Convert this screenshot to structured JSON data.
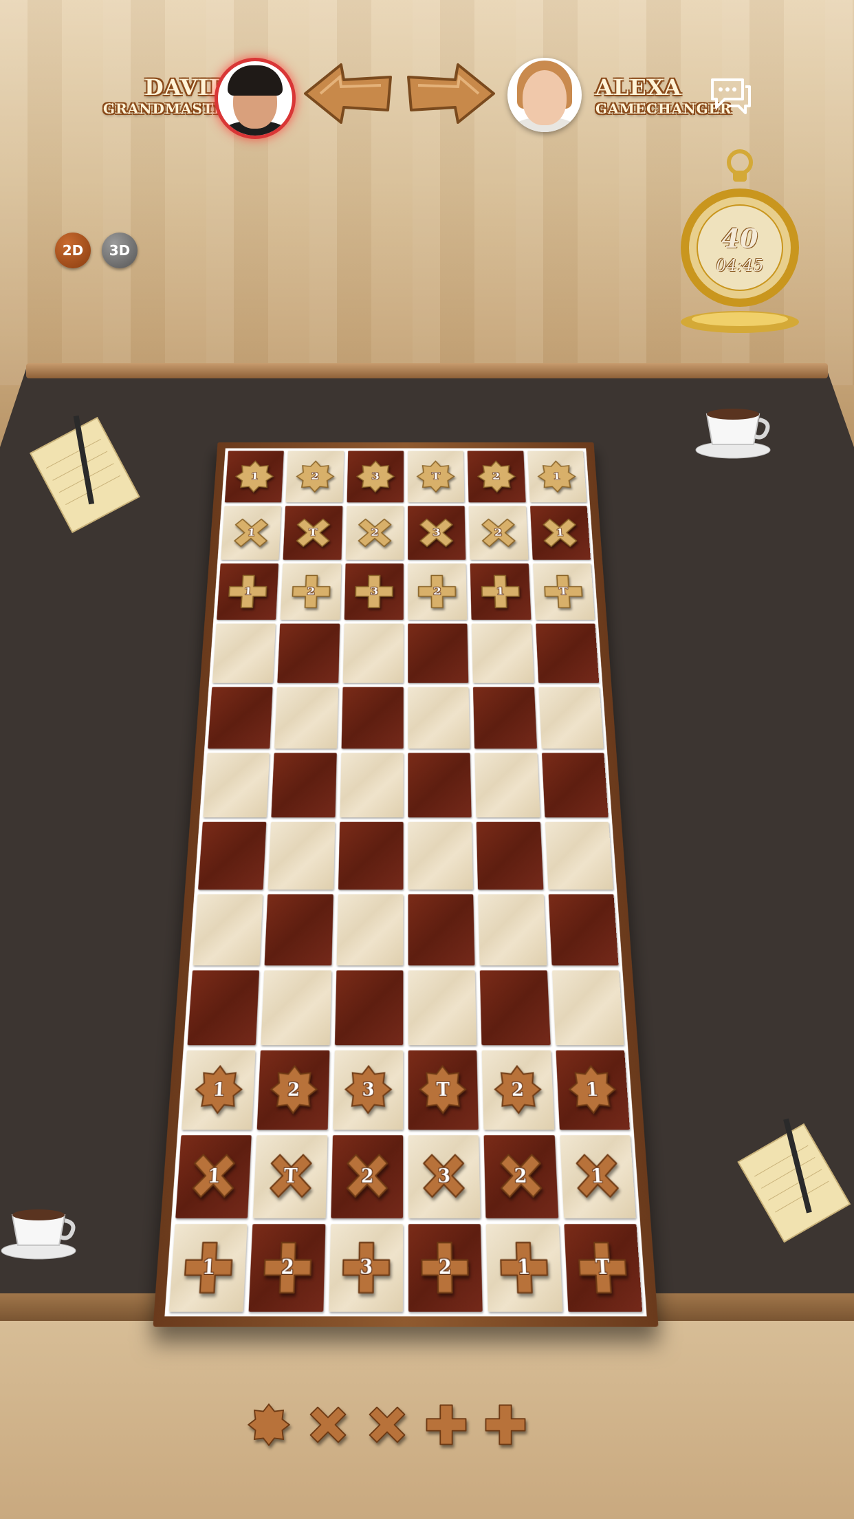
{
  "players": {
    "left": {
      "name": "DAVID",
      "title": "GRANDMASTER",
      "active": true
    },
    "right": {
      "name": "ALEXA",
      "title": "GAMECHANGER",
      "active": false
    }
  },
  "view_modes": [
    "2D",
    "3D"
  ],
  "timer": {
    "moves": "40",
    "time": "04:45"
  },
  "colors": {
    "dark_square": "#6a2414",
    "light_square": "#ece0c6",
    "tan_piece": "#d8b06a",
    "brown_piece": "#b8723a"
  },
  "board": {
    "rows": [
      {
        "shades": [
          "dark",
          "light",
          "dark",
          "light",
          "dark",
          "light"
        ],
        "pieces": [
          {
            "shape": "star",
            "label": "1"
          },
          {
            "shape": "star",
            "label": "2"
          },
          {
            "shape": "star",
            "label": "3"
          },
          {
            "shape": "star",
            "label": "T"
          },
          {
            "shape": "star",
            "label": "2"
          },
          {
            "shape": "star",
            "label": "1"
          }
        ],
        "side": "tan"
      },
      {
        "shades": [
          "light",
          "dark",
          "light",
          "dark",
          "light",
          "dark"
        ],
        "pieces": [
          {
            "shape": "x",
            "label": "1"
          },
          {
            "shape": "x",
            "label": "T"
          },
          {
            "shape": "x",
            "label": "2"
          },
          {
            "shape": "x",
            "label": "3"
          },
          {
            "shape": "x",
            "label": "2"
          },
          {
            "shape": "x",
            "label": "1"
          }
        ],
        "side": "tan"
      },
      {
        "shades": [
          "dark",
          "light",
          "dark",
          "light",
          "dark",
          "light"
        ],
        "pieces": [
          {
            "shape": "plus",
            "label": "1"
          },
          {
            "shape": "plus",
            "label": "2"
          },
          {
            "shape": "plus",
            "label": "3"
          },
          {
            "shape": "plus",
            "label": "2"
          },
          {
            "shape": "plus",
            "label": "1"
          },
          {
            "shape": "plus",
            "label": "T"
          }
        ],
        "side": "tan"
      },
      {
        "shades": [
          "light",
          "dark",
          "light",
          "dark",
          "light",
          "dark"
        ],
        "pieces": []
      },
      {
        "shades": [
          "dark",
          "light",
          "dark",
          "light",
          "dark",
          "light"
        ],
        "pieces": []
      },
      {
        "shades": [
          "light",
          "dark",
          "light",
          "dark",
          "light",
          "dark"
        ],
        "pieces": []
      },
      {
        "shades": [
          "dark",
          "light",
          "dark",
          "light",
          "dark",
          "light"
        ],
        "pieces": []
      },
      {
        "shades": [
          "light",
          "dark",
          "light",
          "dark",
          "light",
          "dark"
        ],
        "pieces": []
      },
      {
        "shades": [
          "dark",
          "light",
          "dark",
          "light",
          "dark",
          "light"
        ],
        "pieces": []
      },
      {
        "shades": [
          "light",
          "dark",
          "light",
          "dark",
          "light",
          "dark"
        ],
        "pieces": [
          {
            "shape": "star",
            "label": "1"
          },
          {
            "shape": "star",
            "label": "2"
          },
          {
            "shape": "star",
            "label": "3"
          },
          {
            "shape": "star",
            "label": "T"
          },
          {
            "shape": "star",
            "label": "2"
          },
          {
            "shape": "star",
            "label": "1"
          }
        ],
        "side": "brown"
      },
      {
        "shades": [
          "dark",
          "light",
          "dark",
          "light",
          "dark",
          "light"
        ],
        "pieces": [
          {
            "shape": "x",
            "label": "1"
          },
          {
            "shape": "x",
            "label": "T"
          },
          {
            "shape": "x",
            "label": "2"
          },
          {
            "shape": "x",
            "label": "3"
          },
          {
            "shape": "x",
            "label": "2"
          },
          {
            "shape": "x",
            "label": "1"
          }
        ],
        "side": "brown"
      },
      {
        "shades": [
          "light",
          "dark",
          "light",
          "dark",
          "light",
          "dark"
        ],
        "pieces": [
          {
            "shape": "plus",
            "label": "1"
          },
          {
            "shape": "plus",
            "label": "2"
          },
          {
            "shape": "plus",
            "label": "3"
          },
          {
            "shape": "plus",
            "label": "2"
          },
          {
            "shape": "plus",
            "label": "1"
          },
          {
            "shape": "plus",
            "label": "T"
          }
        ],
        "side": "brown"
      }
    ]
  },
  "captured": [
    "star",
    "x",
    "x",
    "plus",
    "plus"
  ]
}
